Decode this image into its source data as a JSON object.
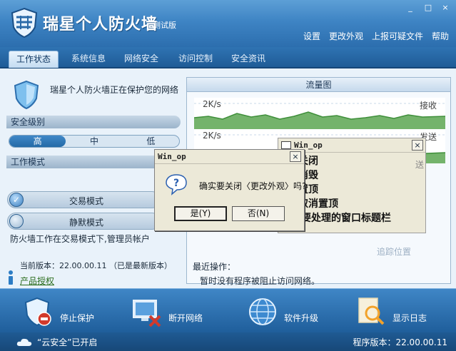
{
  "app": {
    "title": "瑞星个人防火墙",
    "subtitle": "测试版",
    "window_controls": [
      "_",
      "□",
      "×"
    ]
  },
  "top_links": [
    "设置",
    "更改外观",
    "上报可疑文件",
    "帮助"
  ],
  "tabs": [
    {
      "label": "工作状态",
      "active": true
    },
    {
      "label": "系统信息",
      "active": false
    },
    {
      "label": "网络安全",
      "active": false
    },
    {
      "label": "访问控制",
      "active": false
    },
    {
      "label": "安全资讯",
      "active": false
    }
  ],
  "status": {
    "protect_text": "瑞星个人防火墙正在保护您的网络",
    "security_level_label": "安全级别",
    "levels": [
      "高",
      "中",
      "低"
    ],
    "selected_level": "高",
    "work_mode_label": "工作模式",
    "modes": [
      {
        "label": "交易模式",
        "selected": true
      },
      {
        "label": "静默模式",
        "selected": false
      }
    ],
    "description": "防火墙工作在交易模式下,管理员帐户",
    "version_line": "当前版本：22.00.00.11  （已是最新版本）",
    "license_link": "产品授权"
  },
  "traffic": {
    "title": "流量图",
    "receive": {
      "rate": "2K/s",
      "label": "接收"
    },
    "send": {
      "rate": "2K/s",
      "label": "发送"
    },
    "trace_link": "追踪位置",
    "recent_label": "最近操作：",
    "recent_text": "暂时没有程序被阻止访问网络。"
  },
  "toolbar": [
    {
      "label": "停止保护",
      "icon": "shield-stop-icon"
    },
    {
      "label": "断开网络",
      "icon": "monitor-disconnect-icon"
    },
    {
      "label": "软件升级",
      "icon": "globe-upgrade-icon"
    },
    {
      "label": "显示日志",
      "icon": "log-search-icon"
    }
  ],
  "statusbar": {
    "cloud_text": "“云安全”已开启",
    "program_version": "程序版本：22.00.00.11"
  },
  "win_op": {
    "title": "Win_op",
    "close": "×",
    "lines": [
      "关闭",
      "消毁",
      "置顶",
      "取消置顶",
      "点击要处理的窗口标题栏"
    ],
    "stub": "送"
  },
  "dialog": {
    "title": "Win_op",
    "close": "×",
    "message": "确实要关闭〈更改外观〉吗?",
    "yes": "是(Y)",
    "no": "否(N)"
  },
  "colors": {
    "header": "#3e84c4",
    "traffic_line": "#3f8f3a",
    "dialog_bg": "#ece9d8"
  }
}
